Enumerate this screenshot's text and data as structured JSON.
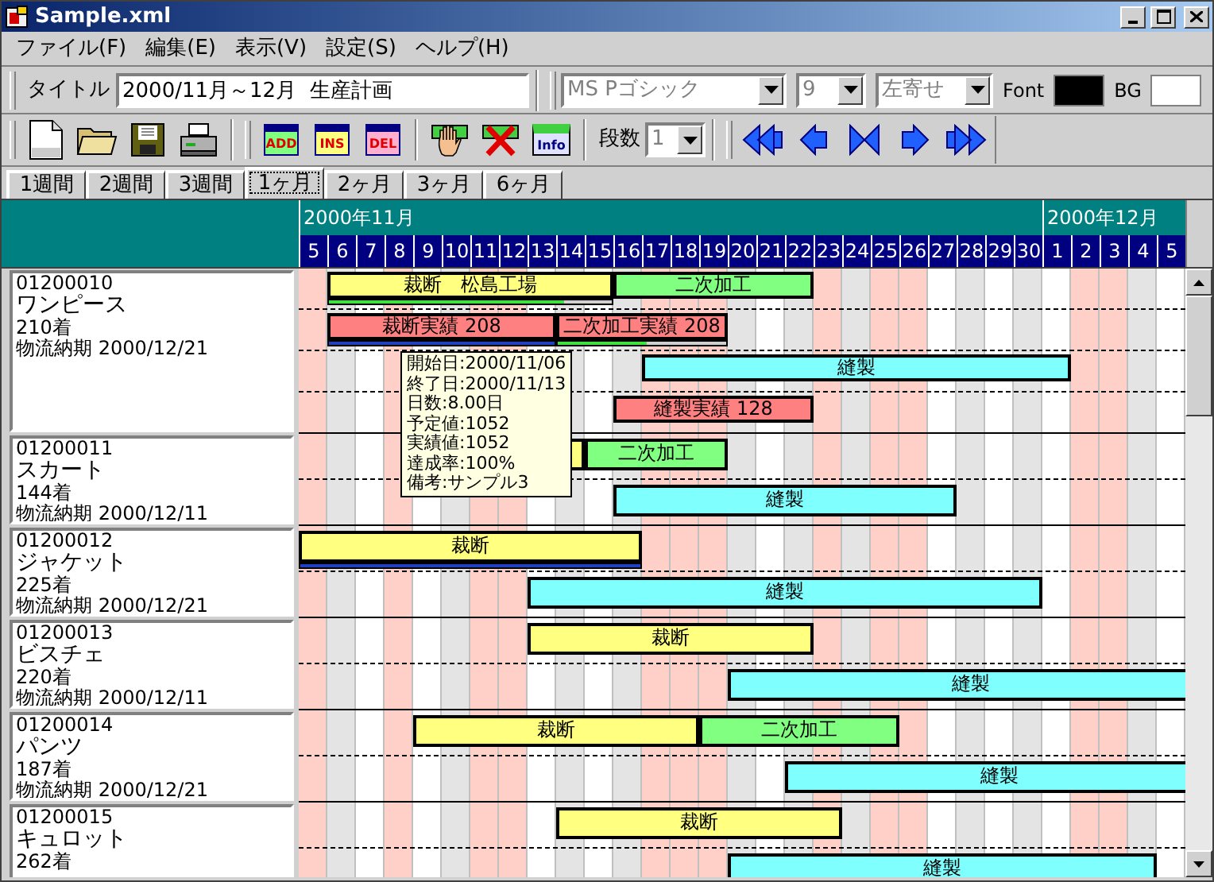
{
  "window": {
    "title": "Sample.xml"
  },
  "menu": [
    {
      "label": "ファイル(F)"
    },
    {
      "label": "編集(E)"
    },
    {
      "label": "表示(V)"
    },
    {
      "label": "設定(S)"
    },
    {
      "label": "ヘルプ(H)"
    }
  ],
  "format_bar": {
    "title_label": "タイトル",
    "title_value": "2000/11月～12月  生産計画",
    "combos": [
      {
        "value": "MS Pゴシック",
        "disabled": true
      },
      {
        "value": "9",
        "disabled": true
      },
      {
        "value": "左寄せ",
        "disabled": true
      }
    ],
    "font_label": "Font",
    "font_swatch": {
      "color": "#000000"
    },
    "bg_label": "BG",
    "bg_swatch": {
      "color": "#ffffff"
    }
  },
  "toolbar": {
    "record_buttons": [
      {
        "label": "ADD"
      },
      {
        "label": "INS"
      },
      {
        "label": "DEL"
      }
    ],
    "info_label": "Info",
    "levels_label": "段数",
    "levels": {
      "value": "1",
      "disabled": true
    }
  },
  "tabs": [
    {
      "label": "1週間",
      "selected": false
    },
    {
      "label": "2週間",
      "selected": false
    },
    {
      "label": "3週間",
      "selected": false
    },
    {
      "label": "1ヶ月",
      "selected": true
    },
    {
      "label": "2ヶ月",
      "selected": false
    },
    {
      "label": "3ヶ月",
      "selected": false
    },
    {
      "label": "6ヶ月",
      "selected": false
    }
  ],
  "timeline": {
    "months": [
      {
        "label": "2000年11月",
        "days": [
          {
            "label": "5",
            "holiday": true,
            "shaded": false
          },
          {
            "label": "6",
            "holiday": false,
            "shaded": true
          },
          {
            "label": "7",
            "holiday": false,
            "shaded": false
          },
          {
            "label": "8",
            "holiday": true,
            "shaded": false
          },
          {
            "label": "9",
            "holiday": false,
            "shaded": false
          },
          {
            "label": "10",
            "holiday": false,
            "shaded": true
          },
          {
            "label": "11",
            "holiday": true,
            "shaded": false
          },
          {
            "label": "12",
            "holiday": true,
            "shaded": false
          },
          {
            "label": "13",
            "holiday": false,
            "shaded": false
          },
          {
            "label": "14",
            "holiday": false,
            "shaded": true
          },
          {
            "label": "15",
            "holiday": false,
            "shaded": false
          },
          {
            "label": "16",
            "holiday": false,
            "shaded": true
          },
          {
            "label": "17",
            "holiday": true,
            "shaded": false
          },
          {
            "label": "18",
            "holiday": true,
            "shaded": false
          },
          {
            "label": "19",
            "holiday": true,
            "shaded": false
          },
          {
            "label": "20",
            "holiday": false,
            "shaded": true
          },
          {
            "label": "21",
            "holiday": false,
            "shaded": false
          },
          {
            "label": "22",
            "holiday": false,
            "shaded": true
          },
          {
            "label": "23",
            "holiday": true,
            "shaded": false
          },
          {
            "label": "24",
            "holiday": false,
            "shaded": true
          },
          {
            "label": "25",
            "holiday": true,
            "shaded": false
          },
          {
            "label": "26",
            "holiday": true,
            "shaded": false
          },
          {
            "label": "27",
            "holiday": false,
            "shaded": false
          },
          {
            "label": "28",
            "holiday": false,
            "shaded": true
          },
          {
            "label": "29",
            "holiday": false,
            "shaded": false
          },
          {
            "label": "30",
            "holiday": false,
            "shaded": true
          }
        ]
      },
      {
        "label": "2000年12月",
        "days": [
          {
            "label": "1",
            "holiday": false,
            "shaded": false
          },
          {
            "label": "2",
            "holiday": true,
            "shaded": false
          },
          {
            "label": "3",
            "holiday": true,
            "shaded": false
          },
          {
            "label": "4",
            "holiday": false,
            "shaded": true
          },
          {
            "label": "5",
            "holiday": false,
            "shaded": false
          }
        ]
      }
    ]
  },
  "orders": [
    {
      "code": "01200010",
      "name": "ワンピース",
      "quantity": "210着",
      "delivery": "物流納期 2000/12/21",
      "lanes": [
        [
          {
            "kind": "cutting",
            "label": "裁断　松島工場",
            "level": 0.83
          },
          {
            "kind": "processing",
            "label": "二次加工"
          }
        ],
        [
          {
            "kind": "actual",
            "label": "裁断実績 208",
            "level": 1
          },
          {
            "kind": "actual",
            "label": "二次加工実績 208",
            "level": 0.53
          }
        ],
        [
          {
            "kind": "sewing",
            "label": "縫製"
          }
        ],
        [
          {
            "kind": "actual",
            "label": "縫製実績 128"
          }
        ]
      ]
    },
    {
      "code": "01200011",
      "name": "スカート",
      "quantity": "144着",
      "delivery": "物流納期 2000/12/11",
      "lanes": [
        [
          {
            "kind": "cutting"
          },
          {
            "kind": "processing",
            "label": "二次加工"
          }
        ],
        [
          {
            "kind": "sewing",
            "label": "縫製"
          }
        ]
      ]
    },
    {
      "code": "01200012",
      "name": "ジャケット",
      "quantity": "225着",
      "delivery": "物流納期 2000/12/21",
      "lanes": [
        [
          {
            "kind": "cutting",
            "label": "裁断",
            "level": 1
          }
        ],
        [
          {
            "kind": "sewing",
            "label": "縫製"
          }
        ]
      ]
    },
    {
      "code": "01200013",
      "name": "ビスチェ",
      "quantity": "220着",
      "delivery": "物流納期 2000/12/11",
      "lanes": [
        [
          {
            "kind": "cutting",
            "label": "裁断"
          }
        ],
        [
          {
            "kind": "sewing",
            "label": "縫製"
          }
        ]
      ]
    },
    {
      "code": "01200014",
      "name": "パンツ",
      "quantity": "187着",
      "delivery": "物流納期 2000/12/21",
      "lanes": [
        [
          {
            "kind": "cutting",
            "label": "裁断"
          },
          {
            "kind": "processing",
            "label": "二次加工"
          }
        ],
        [
          {
            "kind": "sewing",
            "label": "縫製"
          }
        ]
      ]
    },
    {
      "code": "01200015",
      "name": "キュロット",
      "quantity": "262着",
      "lanes": [
        [
          {
            "kind": "cutting",
            "label": "裁断"
          }
        ],
        [
          {
            "kind": "sewing",
            "label": "縫製"
          }
        ]
      ]
    }
  ],
  "tooltip": {
    "lines": [
      "開始日:2000/11/06",
      "終了日:2000/11/13",
      "日数:8.00日",
      "予定値:1052",
      "実績値:1052",
      "達成率:100%",
      "備考:サンプル3"
    ]
  }
}
